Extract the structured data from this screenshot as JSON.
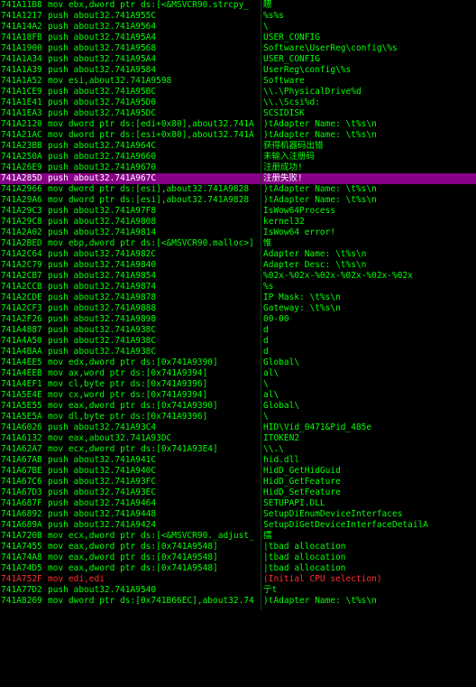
{
  "rows": [
    {
      "addr": "741A11B8",
      "ins": "mov ebx,dword ptr ds:[<&MSVCR90.strcpy_",
      "cmt": "瞟",
      "red": false,
      "sel": false
    },
    {
      "addr": "741A1217",
      "ins": "push about32.741A955C",
      "cmt": "%s%s",
      "red": false,
      "sel": false
    },
    {
      "addr": "741A14A2",
      "ins": "push about32.741A9564",
      "cmt": "\\",
      "red": false,
      "sel": false
    },
    {
      "addr": "741A18FB",
      "ins": "push about32.741A95A4",
      "cmt": "USER_CONFIG",
      "red": false,
      "sel": false
    },
    {
      "addr": "741A1900",
      "ins": "push about32.741A9568",
      "cmt": "Software\\UserReg\\config\\%s",
      "red": false,
      "sel": false
    },
    {
      "addr": "741A1A34",
      "ins": "push about32.741A95A4",
      "cmt": "USER_CONFIG",
      "red": false,
      "sel": false
    },
    {
      "addr": "741A1A39",
      "ins": "push about32.741A9584",
      "cmt": "UserReg\\config\\%s",
      "red": false,
      "sel": false
    },
    {
      "addr": "741A1A52",
      "ins": "mov esi,about32.741A9598",
      "cmt": "Software",
      "red": false,
      "sel": false
    },
    {
      "addr": "741A1CE9",
      "ins": "push about32.741A95BC",
      "cmt": "\\\\.\\PhysicalDrive%d",
      "red": false,
      "sel": false
    },
    {
      "addr": "741A1E41",
      "ins": "push about32.741A95D0",
      "cmt": "\\\\.\\Scsi%d:",
      "red": false,
      "sel": false
    },
    {
      "addr": "741A1EA3",
      "ins": "push about32.741A95DC",
      "cmt": "SCSIDISK",
      "red": false,
      "sel": false
    },
    {
      "addr": "741A2120",
      "ins": "mov dword ptr ds:[edi+0x80],about32.741A",
      "cmt": ")tAdapter Name: \\t%s\\n",
      "red": false,
      "sel": false
    },
    {
      "addr": "741A21AC",
      "ins": "mov dword ptr ds:[esi+0x80],about32.741A",
      "cmt": ")tAdapter Name: \\t%s\\n",
      "red": false,
      "sel": false
    },
    {
      "addr": "741A23BB",
      "ins": "push about32.741A964C",
      "cmt": "获得机器码出错",
      "red": false,
      "sel": false
    },
    {
      "addr": "741A250A",
      "ins": "push about32.741A9660",
      "cmt": "未输入注册码",
      "red": false,
      "sel": false
    },
    {
      "addr": "741A26E9",
      "ins": "push about32.741A9670",
      "cmt": "注册成功!",
      "red": false,
      "sel": false
    },
    {
      "addr": "741A285D",
      "ins": "push about32.741A967C",
      "cmt": "注册失败!",
      "red": false,
      "sel": true
    },
    {
      "addr": "741A2966",
      "ins": "mov dword ptr ds:[esi],about32.741A9828",
      "cmt": ")tAdapter Name: \\t%s\\n",
      "red": false,
      "sel": false
    },
    {
      "addr": "741A29A6",
      "ins": "mov dword ptr ds:[esi],about32.741A9828",
      "cmt": ")tAdapter Name: \\t%s\\n",
      "red": false,
      "sel": false
    },
    {
      "addr": "741A29C3",
      "ins": "push about32.741A97F8",
      "cmt": "IsWow64Process",
      "red": false,
      "sel": false
    },
    {
      "addr": "741A29C8",
      "ins": "push about32.741A9808",
      "cmt": "kernel32",
      "red": false,
      "sel": false
    },
    {
      "addr": "741A2A02",
      "ins": "push about32.741A9814",
      "cmt": "IsWow64 error!",
      "red": false,
      "sel": false
    },
    {
      "addr": "741A2BED",
      "ins": "mov ebp,dword ptr ds:[<&MSVCR90.malloc>]",
      "cmt": "惟",
      "red": false,
      "sel": false
    },
    {
      "addr": "741A2C64",
      "ins": "push about32.741A982C",
      "cmt": "Adapter Name: \\t%s\\n",
      "red": false,
      "sel": false
    },
    {
      "addr": "741A2C79",
      "ins": "push about32.741A9840",
      "cmt": "Adapter Desc: \\t%s\\n",
      "red": false,
      "sel": false
    },
    {
      "addr": "741A2CB7",
      "ins": "push about32.741A9854",
      "cmt": "%02x-%02x-%02x-%02x-%02x-%02x",
      "red": false,
      "sel": false
    },
    {
      "addr": "741A2CCB",
      "ins": "push about32.741A9874",
      "cmt": "%s",
      "red": false,
      "sel": false
    },
    {
      "addr": "741A2CDE",
      "ins": "push about32.741A9878",
      "cmt": "IP Mask: \\t%s\\n",
      "red": false,
      "sel": false
    },
    {
      "addr": "741A2CF3",
      "ins": "push about32.741A9888",
      "cmt": "Gateway: \\t%s\\n",
      "red": false,
      "sel": false
    },
    {
      "addr": "741A2F26",
      "ins": "push about32.741A9898",
      "cmt": "00-00",
      "red": false,
      "sel": false
    },
    {
      "addr": "741A4887",
      "ins": "push about32.741A938C",
      "cmt": "d",
      "red": false,
      "sel": false
    },
    {
      "addr": "741A4A50",
      "ins": "push about32.741A938C",
      "cmt": "d",
      "red": false,
      "sel": false
    },
    {
      "addr": "741A4BAA",
      "ins": "push about32.741A938C",
      "cmt": "d",
      "red": false,
      "sel": false
    },
    {
      "addr": "741A4EE5",
      "ins": "mov edx,dword ptr ds:[0x741A9390]",
      "cmt": "Global\\",
      "red": false,
      "sel": false
    },
    {
      "addr": "741A4EEB",
      "ins": "mov ax,word ptr ds:[0x741A9394]",
      "cmt": "al\\",
      "red": false,
      "sel": false
    },
    {
      "addr": "741A4EF1",
      "ins": "mov cl,byte ptr ds:[0x741A9396]",
      "cmt": "\\",
      "red": false,
      "sel": false
    },
    {
      "addr": "741A5E4E",
      "ins": "mov cx,word ptr ds:[0x741A9394]",
      "cmt": "al\\",
      "red": false,
      "sel": false
    },
    {
      "addr": "741A5E55",
      "ins": "mov eax,dword ptr ds:[0x741A9390]",
      "cmt": "Global\\",
      "red": false,
      "sel": false
    },
    {
      "addr": "741A5E5A",
      "ins": "mov dl,byte ptr ds:[0x741A9396]",
      "cmt": "\\",
      "red": false,
      "sel": false
    },
    {
      "addr": "741A6026",
      "ins": "push about32.741A93C4",
      "cmt": "HID\\Vid_0471&Pid_485e",
      "red": false,
      "sel": false
    },
    {
      "addr": "741A6132",
      "ins": "mov eax,about32.741A93DC",
      "cmt": "ITOKEN2",
      "red": false,
      "sel": false
    },
    {
      "addr": "741A62A7",
      "ins": "mov ecx,dword ptr ds:[0x741A93E4]",
      "cmt": "\\\\.\\",
      "red": false,
      "sel": false
    },
    {
      "addr": "741A67AB",
      "ins": "push about32.741A941C",
      "cmt": "hid.dll",
      "red": false,
      "sel": false
    },
    {
      "addr": "741A67BE",
      "ins": "push about32.741A940C",
      "cmt": "HidD_GetHidGuid",
      "red": false,
      "sel": false
    },
    {
      "addr": "741A67C6",
      "ins": "push about32.741A93FC",
      "cmt": "HidD_GetFeature",
      "red": false,
      "sel": false
    },
    {
      "addr": "741A67D3",
      "ins": "push about32.741A93EC",
      "cmt": "HidD_SetFeature",
      "red": false,
      "sel": false
    },
    {
      "addr": "741A687F",
      "ins": "push about32.741A9464",
      "cmt": "SETUPAPI.DLL",
      "red": false,
      "sel": false
    },
    {
      "addr": "741A6892",
      "ins": "push about32.741A9448",
      "cmt": "SetupDiEnumDeviceInterfaces",
      "red": false,
      "sel": false
    },
    {
      "addr": "741A689A",
      "ins": "push about32.741A9424",
      "cmt": "SetupDiGetDeviceInterfaceDetailA",
      "red": false,
      "sel": false
    },
    {
      "addr": "741A720B",
      "ins": "mov ecx,dword ptr ds:[<&MSVCR90._adjust_",
      "cmt": "擂",
      "red": false,
      "sel": false
    },
    {
      "addr": "741A7455",
      "ins": "mov eax,dword ptr ds:[0x741A9548]",
      "cmt": "|tbad allocation",
      "red": false,
      "sel": false
    },
    {
      "addr": "741A74A8",
      "ins": "mov eax,dword ptr ds:[0x741A9548]",
      "cmt": "|tbad allocation",
      "red": false,
      "sel": false
    },
    {
      "addr": "741A74D5",
      "ins": "mov eax,dword ptr ds:[0x741A9548]",
      "cmt": "|tbad allocation",
      "red": false,
      "sel": false
    },
    {
      "addr": "741A752F",
      "ins": "mov edi,edi",
      "cmt": "(Initial CPU selection)",
      "red": true,
      "sel": false
    },
    {
      "addr": "741A77D2",
      "ins": "push about32.741A9540",
      "cmt": "亍t",
      "red": false,
      "sel": false
    },
    {
      "addr": "741A8269",
      "ins": "mov dword ptr ds:[0x741B66EC],about32.74",
      "cmt": ")tAdapter Name: \\t%s\\n",
      "red": false,
      "sel": false
    }
  ],
  "colors": {
    "text": "#00ff00",
    "selected_bg": "#880088",
    "initial": "#ff3030",
    "background": "#000000"
  }
}
